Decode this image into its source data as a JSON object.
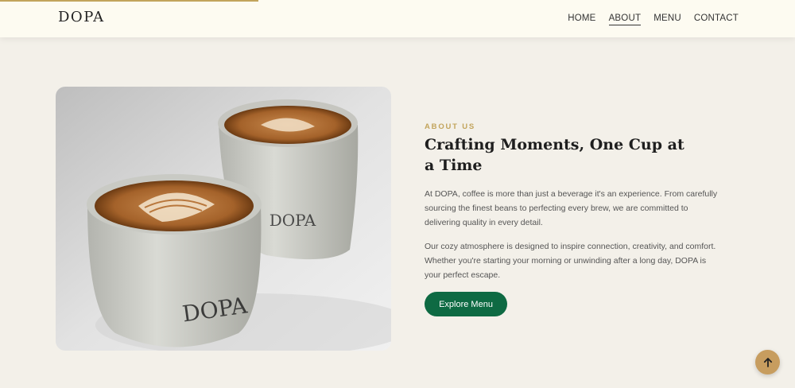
{
  "progress": {
    "scroll_fraction": 0.325,
    "color": "#c2a45c"
  },
  "header": {
    "logo": "DOPA",
    "nav": [
      "HOME",
      "ABOUT",
      "MENU",
      "CONTACT"
    ],
    "active_nav": "ABOUT"
  },
  "photo": {
    "cup_text": "DOPA"
  },
  "about": {
    "eyebrow": "ABOUT US",
    "title": "Crafting Moments, One Cup at a Time",
    "paragraph1": "At DOPA, coffee is more than just a beverage it's an experience. From carefully sourcing the finest beans to perfecting every brew, we are committed to delivering quality in every detail.",
    "paragraph2": "Our cozy atmosphere is designed to inspire connection, creativity, and comfort. Whether you're starting your morning or unwinding after a long day, DOPA is your perfect escape.",
    "button": "Explore Menu"
  },
  "colors": {
    "background": "#f3f0e9",
    "header": "#fdfbf1",
    "accent": "#c2a45c",
    "button": "#0e6a43",
    "back_to_top": "#c79d5f"
  },
  "icons": {
    "back_to_top": "arrow-up-icon"
  }
}
